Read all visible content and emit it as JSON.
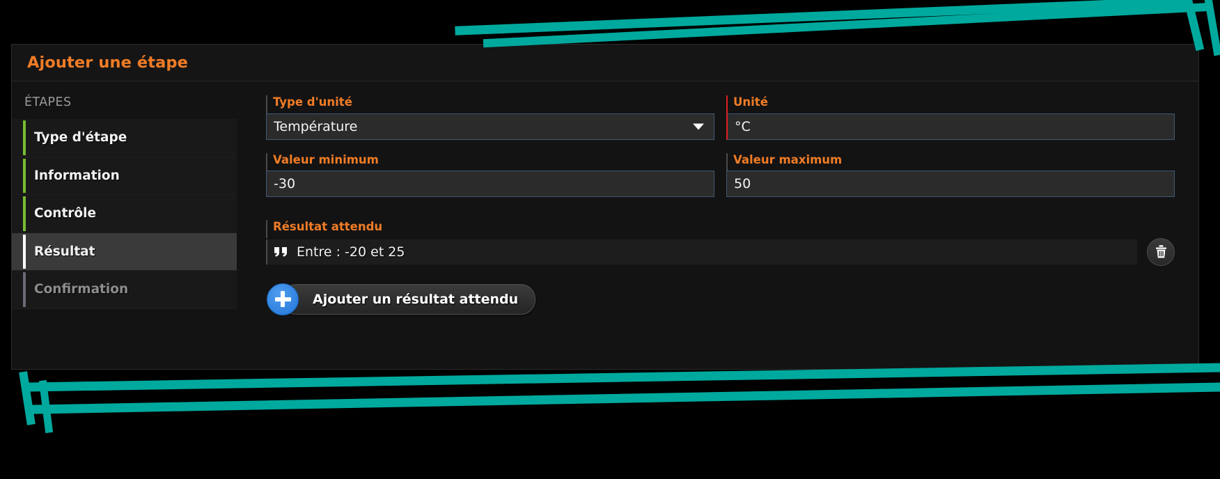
{
  "dialog": {
    "title": "Ajouter une étape"
  },
  "sidebar": {
    "heading": "ÉTAPES",
    "items": [
      {
        "label": "Type d'étape",
        "state": "done"
      },
      {
        "label": "Information",
        "state": "done"
      },
      {
        "label": "Contrôle",
        "state": "done"
      },
      {
        "label": "Résultat",
        "state": "active"
      },
      {
        "label": "Confirmation",
        "state": "disabled"
      }
    ]
  },
  "form": {
    "unit_type": {
      "label": "Type d'unité",
      "value": "Température",
      "icon": "chevron-down-icon"
    },
    "unit": {
      "label": "Unité",
      "value": "°C",
      "required": true
    },
    "min_value": {
      "label": "Valeur minimum",
      "value": "-30"
    },
    "max_value": {
      "label": "Valeur maximum",
      "value": "50"
    },
    "expected_result": {
      "label": "Résultat attendu",
      "items": [
        {
          "icon": "quote-icon",
          "text": "Entre : -20 et 25",
          "delete_icon": "trash-icon"
        }
      ],
      "add_label": "Ajouter un résultat attendu",
      "add_icon": "plus-icon"
    }
  },
  "colors": {
    "accent_orange": "#f07c26",
    "required_red": "#e02020",
    "step_done_green": "#76bd31",
    "step_active_white": "#ffffff",
    "step_pending_gray": "#6a6a78",
    "add_button_blue": "#2277d8",
    "annotation_teal": "#00a99d"
  },
  "annotation": {
    "type": "teal-highlight-rectangle",
    "color": "#00a99d"
  }
}
